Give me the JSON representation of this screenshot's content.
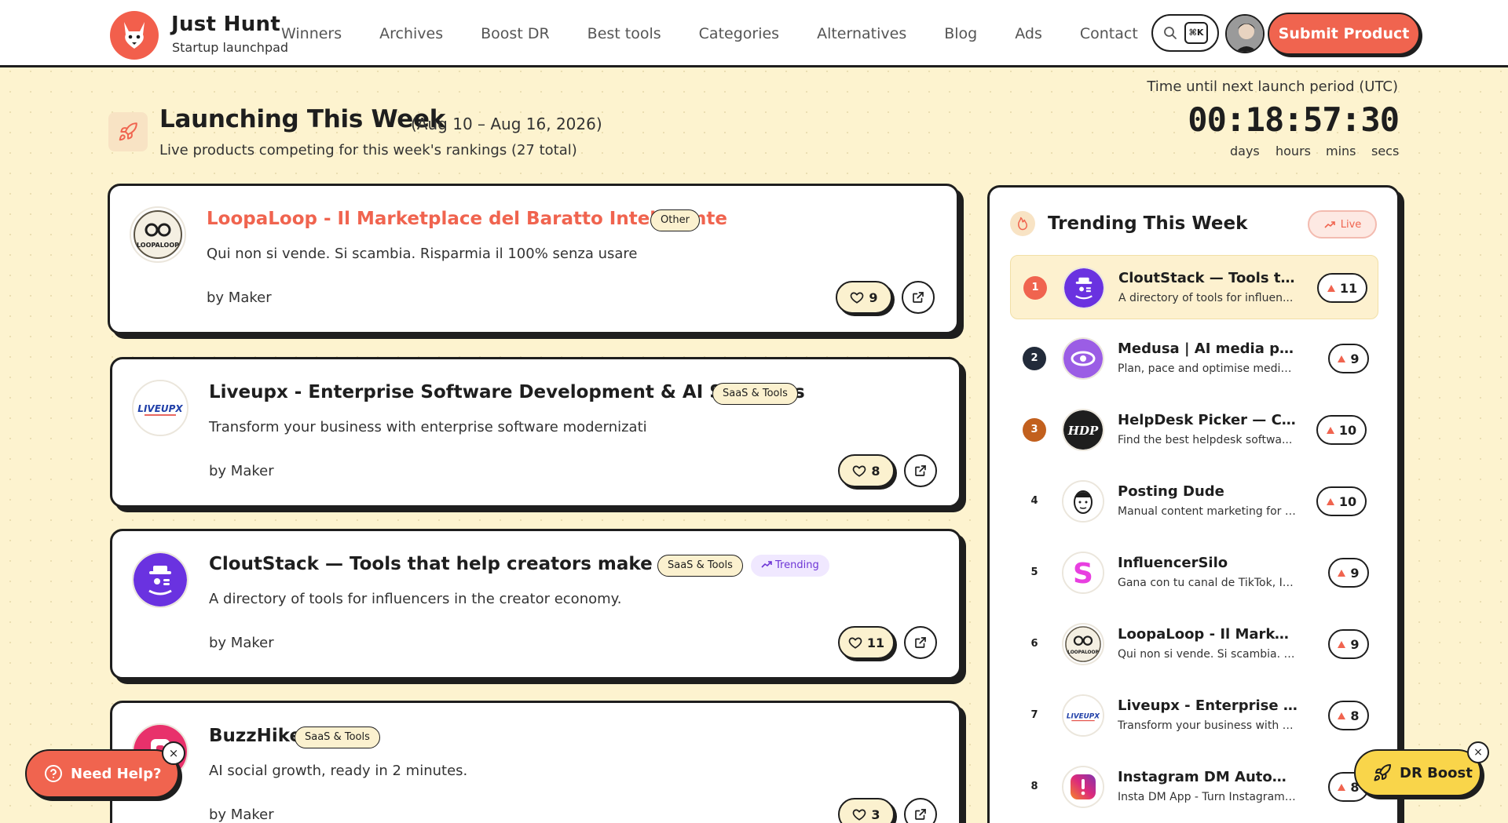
{
  "brand": {
    "name": "Just Hunt",
    "tagline": "Startup launchpad"
  },
  "nav": [
    "Winners",
    "Archives",
    "Boost DR",
    "Best tools",
    "Categories",
    "Alternatives",
    "Blog",
    "Ads",
    "Contact"
  ],
  "search": {
    "shortcut": "⌘K",
    "icon": "search-icon"
  },
  "header": {
    "submit_label": "Submit Product"
  },
  "colors": {
    "accent": "#f0644f",
    "background": "#fdf3cf",
    "ink": "#1e1e1e",
    "yellow": "#f9d54a"
  },
  "page": {
    "title": "Launching This Week",
    "dates": "(Aug 10 – Aug 16, 2026)",
    "subtitle": "Live products competing for this week's rankings (27 total)"
  },
  "timer": {
    "label": "Time until next launch period (UTC)",
    "days": "00",
    "hours": "18",
    "mins": "57",
    "secs": "30",
    "units": {
      "days": "days",
      "hours": "hours",
      "mins": "mins",
      "secs": "secs"
    }
  },
  "products": [
    {
      "name": "LoopaLoop - Il Marketplace del Baratto Intelligente",
      "tags": [
        "Other"
      ],
      "desc": "Qui non si vende. Si scambia. Risparmia il 100% senza usare",
      "by": "by Maker",
      "votes": "9"
    },
    {
      "name": "Liveupx - Enterprise Software Development & AI Solutions",
      "tags": [
        "SaaS & Tools"
      ],
      "desc": "Transform your business with enterprise software modernizati",
      "by": "by Maker",
      "votes": "8"
    },
    {
      "name": "CloutStack — Tools that help creators make money",
      "tags": [
        "SaaS & Tools"
      ],
      "trending": "Trending",
      "desc": "A directory of tools for influencers in the creator economy.",
      "by": "by Maker",
      "votes": "11"
    },
    {
      "name": "BuzzHike",
      "tags": [
        "SaaS & Tools"
      ],
      "desc": "AI social growth, ready in 2 minutes.",
      "by": "by Maker",
      "votes": "3"
    }
  ],
  "trending": {
    "title": "Trending This Week",
    "badge": "Live",
    "items": [
      {
        "rank": "1",
        "name": "CloutStack — Tools th...",
        "desc": "A directory of tools for influen...",
        "votes": "11"
      },
      {
        "rank": "2",
        "name": "Medusa | AI media plan...",
        "desc": "Plan, pace and optimise media ...",
        "votes": "9"
      },
      {
        "rank": "3",
        "name": "HelpDesk Picker — Co...",
        "desc": "Find the best helpdesk softwa...",
        "votes": "10"
      },
      {
        "rank": "4",
        "name": "Posting Dude",
        "desc": "Manual content marketing for i...",
        "votes": "10"
      },
      {
        "rank": "5",
        "name": "InfluencerSilo",
        "desc": "Gana con tu canal de TikTok, In...",
        "votes": "9"
      },
      {
        "rank": "6",
        "name": "LoopaLoop - Il Marketpl...",
        "desc": "Qui non si vende. Si scambia. Ri...",
        "votes": "9"
      },
      {
        "rank": "7",
        "name": "Liveupx - Enterprise Sof...",
        "desc": "Transform your business with e...",
        "votes": "8"
      },
      {
        "rank": "8",
        "name": "Instagram DM Automati...",
        "desc": "Insta DM App - Turn Instagram ...",
        "votes": "8"
      }
    ]
  },
  "thumbs": {
    "loopaloop": "LOOPALOOP",
    "liveupx": "LIVEUPX",
    "helpdesk": "HDP"
  },
  "help": {
    "label": "Need Help?",
    "close": "×"
  },
  "dr_boost": {
    "label": "DR Boost",
    "close": "×"
  }
}
